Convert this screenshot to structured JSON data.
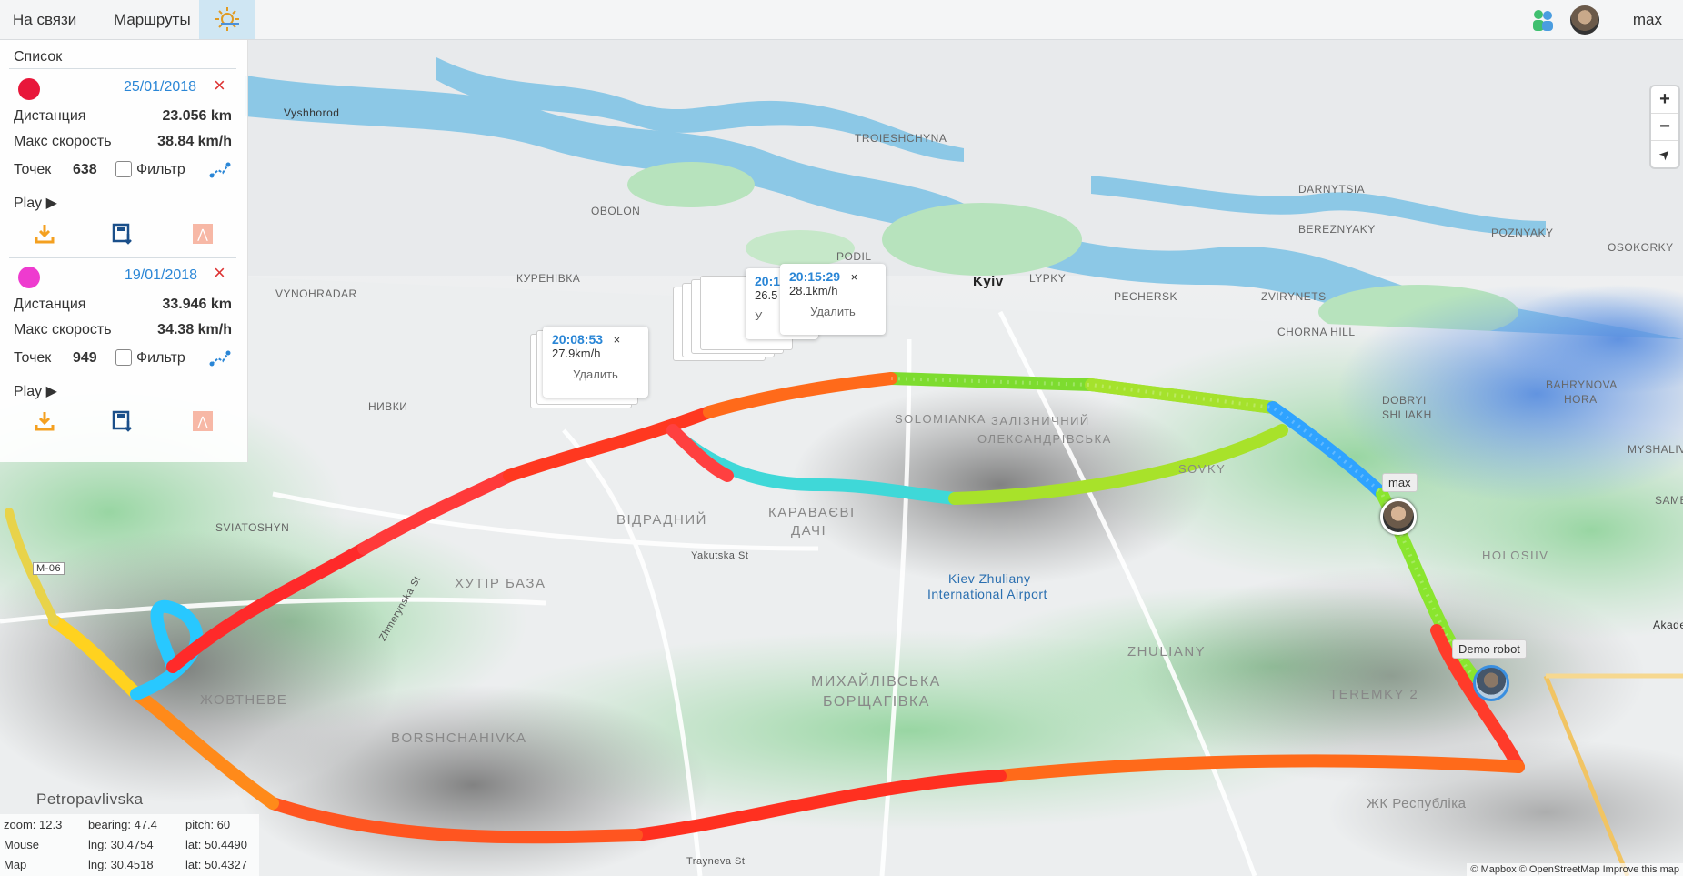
{
  "nav": {
    "tab_online": "На связи",
    "tab_routes": "Маршруты",
    "user_name": "max"
  },
  "panel": {
    "list_title": "Список",
    "routes": [
      {
        "date": "25/01/2018",
        "color": "#e8173a",
        "distance_label": "Дистанция",
        "distance": "23.056 km",
        "speed_label": "Макс скорость",
        "speed": "38.84 km/h",
        "points_label": "Точек",
        "points": "638",
        "filter_label": "Фильтр",
        "play_label": "Play ▶"
      },
      {
        "date": "19/01/2018",
        "color": "#ee3bcf",
        "distance_label": "Дистанция",
        "distance": "33.946 km",
        "speed_label": "Макс скорость",
        "speed": "34.38 km/h",
        "points_label": "Точек",
        "points": "949",
        "filter_label": "Фильтр",
        "play_label": "Play ▶"
      }
    ]
  },
  "popups": [
    {
      "time": "20:08:53",
      "speed": "27.9km/h",
      "delete": "Удалить"
    },
    {
      "time": "20:15:29",
      "speed": "28.1km/h",
      "delete": "Удалить"
    }
  ],
  "popup_partials": {
    "p1": "20:1",
    "p2": "26.5",
    "p3": "У"
  },
  "markers": {
    "max_label": "max",
    "robot_label": "Demo robot"
  },
  "map_labels": {
    "kyiv": "Kyiv",
    "vidradnyi": "ВІДРАДНИЙ",
    "karavaevi": "КАРАВАЄВІ",
    "dachi": "ДАЧІ",
    "khutir": "ХУТІР БАЗА",
    "mykhailivska": "МИХАЙЛІВСЬКА",
    "borshchahivka": "БОРЩАГІВКА",
    "borshchahivka_lat": "BORSHCHAHIVKA",
    "zhovtneve": "ЖОВТНЕВЕ",
    "zhuliany": "ZHULIANY",
    "teremky": "TEREMKY 2",
    "solomianka": "SOLOMIANKA",
    "zaliznychnyi": "ЗАЛІЗНИЧНИЙ",
    "oleksandrivska": "ОЛЕКСАНДРІВСЬКА",
    "sovky": "SOVKY",
    "holosiiv": "HOLOSIIV",
    "airport1": "Kiev Zhuliany",
    "airport2": "International Airport",
    "petropavlivska": "Petropavlivska",
    "obolon": "OBOLON",
    "podil": "PODIL",
    "kurenivka": "КУРЕНІВКА",
    "lypky": "LYPKY",
    "pechersk": "PECHERSK",
    "zvirynets": "ZVIRYNETS",
    "darnytsia": "DARNYTSIA",
    "bereznyaky": "BEREZNYAKY",
    "osokorky": "OSOKORKY",
    "vynohradar": "VYNOHRADAR",
    "nyvky": "НИВКИ",
    "sviatoshyn": "SVIATOSHYN",
    "chorna_hill": "CHORNA HILL",
    "bahrynova": "BAHRYNOVA",
    "hora": "HORA",
    "myshaliv": "MYSHALIV",
    "sambi": "SAMBI",
    "dobryi1": "DOBRYI",
    "dobryi2": "SHLIAKH",
    "gk": "ЖК Республіка",
    "troieshchyna": "TROIESHCHYNA",
    "pozniaky": "POZNYAKY",
    "vyshhorod": "Vyshhorod",
    "akadem": "Akadem",
    "yakutska": "Yakutska St",
    "trayneva": "Trayneva St",
    "zhmerynska": "Zhmerynska St",
    "m06": "M-06"
  },
  "coords": {
    "zoom": "zoom: 12.3",
    "bearing": "bearing: 47.4",
    "pitch": "pitch: 60",
    "mouse_label": "Mouse",
    "mouse_lng": "lng: 30.4754",
    "mouse_lat": "lat: 50.4490",
    "map_label": "Map",
    "map_lng": "lng: 30.4518",
    "map_lat": "lat: 50.4327"
  },
  "attribution": "© Mapbox © OpenStreetMap  Improve this map",
  "controls": {
    "zoom_in": "+",
    "zoom_out": "−",
    "compass": "➤"
  }
}
